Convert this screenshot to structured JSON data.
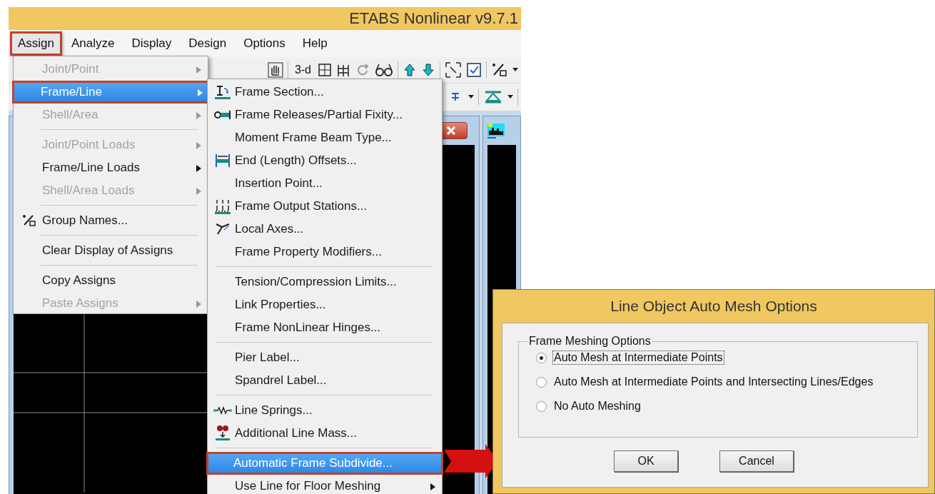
{
  "app": {
    "title": "ETABS Nonlinear v9.7.1",
    "menu_bar": [
      {
        "label": "Assign",
        "selected": true,
        "highlighted": true
      },
      {
        "label": "Analyze",
        "selected": false,
        "highlighted": false
      },
      {
        "label": "Display",
        "selected": false,
        "highlighted": false
      },
      {
        "label": "Design",
        "selected": false,
        "highlighted": false
      },
      {
        "label": "Options",
        "selected": false,
        "highlighted": false
      },
      {
        "label": "Help",
        "selected": false,
        "highlighted": false
      }
    ],
    "toolbar": {
      "view_3d_label": "3-d"
    }
  },
  "assign_menu": {
    "items": [
      {
        "kind": "item",
        "label": "Joint/Point",
        "disabled": true,
        "submenu": true,
        "selected": false,
        "highlighted": false
      },
      {
        "kind": "item",
        "label": "Frame/Line",
        "disabled": false,
        "submenu": true,
        "selected": true,
        "highlighted": true
      },
      {
        "kind": "item",
        "label": "Shell/Area",
        "disabled": true,
        "submenu": true,
        "selected": false,
        "highlighted": false
      },
      {
        "kind": "separator"
      },
      {
        "kind": "item",
        "label": "Joint/Point Loads",
        "disabled": true,
        "submenu": true,
        "selected": false,
        "highlighted": false
      },
      {
        "kind": "item",
        "label": "Frame/Line Loads",
        "disabled": false,
        "submenu": true,
        "selected": false,
        "highlighted": false
      },
      {
        "kind": "item",
        "label": "Shell/Area Loads",
        "disabled": true,
        "submenu": true,
        "selected": false,
        "highlighted": false
      },
      {
        "kind": "separator"
      },
      {
        "kind": "icon-item",
        "label": "Group Names...",
        "disabled": false,
        "submenu": false,
        "selected": false,
        "highlighted": false
      },
      {
        "kind": "separator"
      },
      {
        "kind": "item",
        "label": "Clear Display of Assigns",
        "disabled": false,
        "submenu": false,
        "selected": false,
        "highlighted": false
      },
      {
        "kind": "separator"
      },
      {
        "kind": "item",
        "label": "Copy Assigns",
        "disabled": false,
        "submenu": false,
        "selected": false,
        "highlighted": false
      },
      {
        "kind": "item",
        "label": "Paste Assigns",
        "disabled": true,
        "submenu": true,
        "selected": false,
        "highlighted": false
      }
    ]
  },
  "frame_line_submenu": {
    "items": [
      {
        "kind": "icon-item",
        "label": "Frame Section...",
        "submenu": false,
        "selected": false,
        "highlighted": false
      },
      {
        "kind": "icon-item",
        "label": "Frame Releases/Partial Fixity...",
        "submenu": false,
        "selected": false,
        "highlighted": false
      },
      {
        "kind": "item",
        "label": "Moment Frame Beam Type...",
        "submenu": false,
        "selected": false,
        "highlighted": false
      },
      {
        "kind": "icon-item",
        "label": "End (Length) Offsets...",
        "submenu": false,
        "selected": false,
        "highlighted": false
      },
      {
        "kind": "item",
        "label": "Insertion Point...",
        "submenu": false,
        "selected": false,
        "highlighted": false
      },
      {
        "kind": "icon-item",
        "label": "Frame Output Stations...",
        "submenu": false,
        "selected": false,
        "highlighted": false
      },
      {
        "kind": "icon-item",
        "label": "Local Axes...",
        "submenu": false,
        "selected": false,
        "highlighted": false
      },
      {
        "kind": "item",
        "label": "Frame Property Modifiers...",
        "submenu": false,
        "selected": false,
        "highlighted": false
      },
      {
        "kind": "separator"
      },
      {
        "kind": "item",
        "label": "Tension/Compression Limits...",
        "submenu": false,
        "selected": false,
        "highlighted": false
      },
      {
        "kind": "item",
        "label": "Link Properties...",
        "submenu": false,
        "selected": false,
        "highlighted": false
      },
      {
        "kind": "item",
        "label": "Frame NonLinear Hinges...",
        "submenu": false,
        "selected": false,
        "highlighted": false
      },
      {
        "kind": "separator"
      },
      {
        "kind": "item",
        "label": "Pier Label...",
        "submenu": false,
        "selected": false,
        "highlighted": false
      },
      {
        "kind": "item",
        "label": "Spandrel Label...",
        "submenu": false,
        "selected": false,
        "highlighted": false
      },
      {
        "kind": "separator"
      },
      {
        "kind": "icon-item",
        "label": "Line Springs...",
        "submenu": false,
        "selected": false,
        "highlighted": false
      },
      {
        "kind": "icon-item",
        "label": "Additional Line Mass...",
        "submenu": false,
        "selected": false,
        "highlighted": false
      },
      {
        "kind": "separator"
      },
      {
        "kind": "item",
        "label": "Automatic Frame Subdivide...",
        "submenu": false,
        "selected": true,
        "highlighted": true
      },
      {
        "kind": "item",
        "label": "Use Line for Floor Meshing",
        "submenu": true,
        "selected": false,
        "highlighted": false
      }
    ]
  },
  "dialog": {
    "title": "Line Object Auto Mesh Options",
    "group_label": "Frame Meshing Options",
    "options": [
      {
        "label": "Auto Mesh at Intermediate Points",
        "selected": true,
        "focused": true
      },
      {
        "label": "Auto Mesh at Intermediate Points and Intersecting Lines/Edges",
        "selected": false,
        "focused": false
      },
      {
        "label": "No Auto Meshing",
        "selected": false,
        "focused": false
      }
    ],
    "buttons": [
      "OK",
      "Cancel"
    ]
  }
}
